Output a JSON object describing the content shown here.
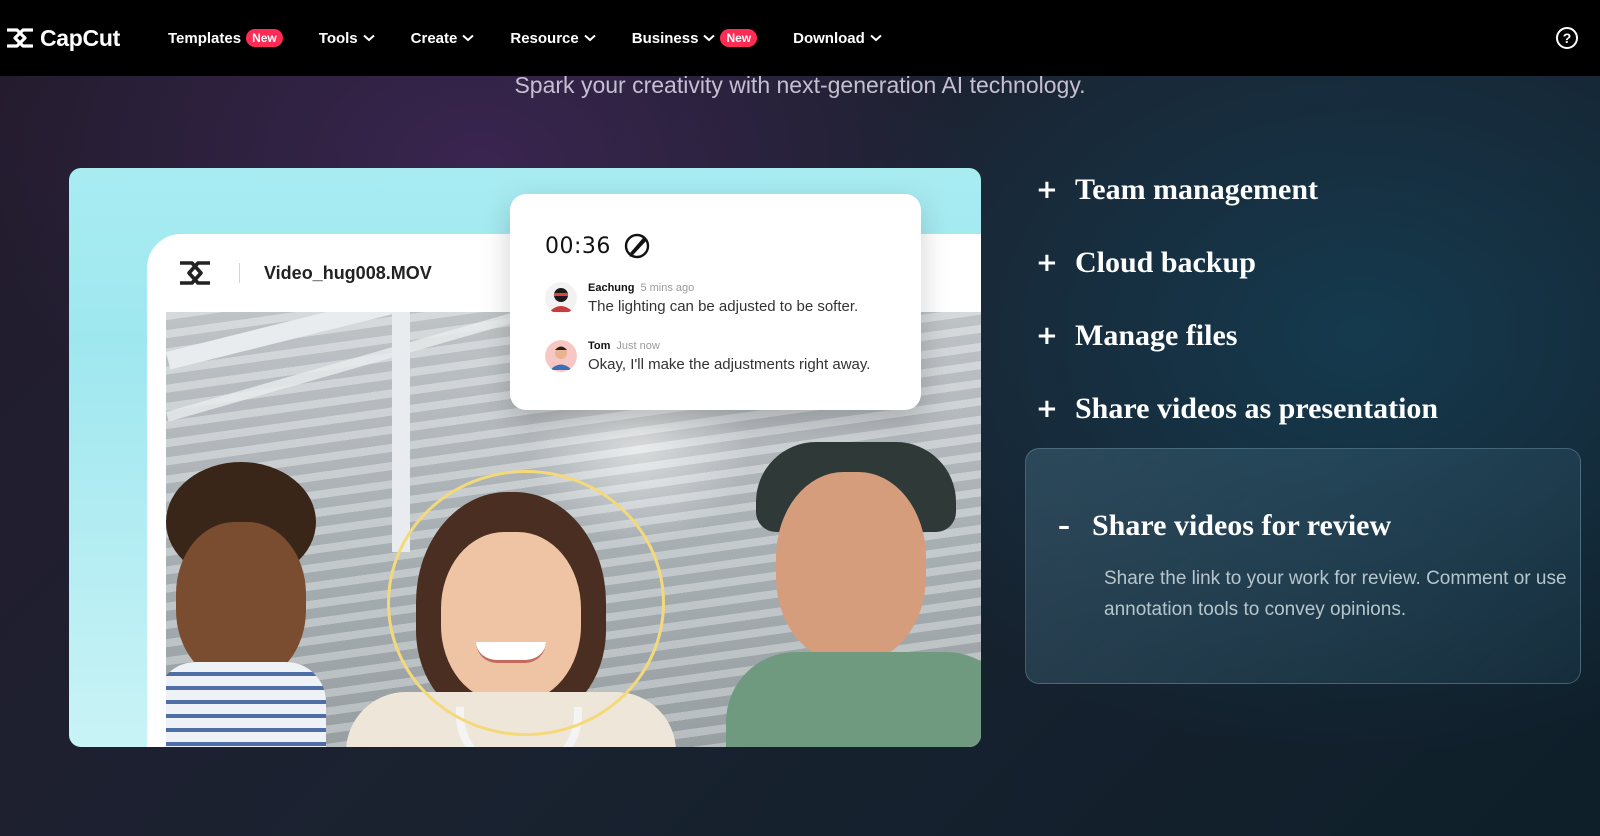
{
  "nav": {
    "logo_text": "CapCut",
    "items": [
      {
        "label": "Templates",
        "badge": "New",
        "chevron": false
      },
      {
        "label": "Tools",
        "badge": "",
        "chevron": true
      },
      {
        "label": "Create",
        "badge": "",
        "chevron": true
      },
      {
        "label": "Resource",
        "badge": "",
        "chevron": true
      },
      {
        "label": "Business",
        "badge": "New",
        "chevron": true
      },
      {
        "label": "Download",
        "badge": "",
        "chevron": true
      }
    ],
    "help_symbol": "?"
  },
  "hero": {
    "subtitle": "Spark your creativity with next-generation AI technology."
  },
  "player": {
    "file_name": "Video_hug008.MOV",
    "timestamp": "00:36",
    "comments": [
      {
        "author": "Eachung",
        "time": "5 mins ago",
        "text": "The lighting can be adjusted to be softer."
      },
      {
        "author": "Tom",
        "time": "Just now",
        "text": "Okay, I'll make the adjustments right away."
      }
    ]
  },
  "features": {
    "items": [
      {
        "sign": "+",
        "title": "Team management"
      },
      {
        "sign": "+",
        "title": "Cloud backup"
      },
      {
        "sign": "+",
        "title": "Manage files"
      },
      {
        "sign": "+",
        "title": "Share videos as presentation"
      }
    ],
    "active": {
      "sign": "–",
      "title": "Share videos for review",
      "description": "Share the link to your work for review. Comment or use annotation tools to convey opinions."
    }
  },
  "colors": {
    "badge": "#fe2c55",
    "ring": "#f4d97a",
    "nav_bg": "#000000"
  }
}
